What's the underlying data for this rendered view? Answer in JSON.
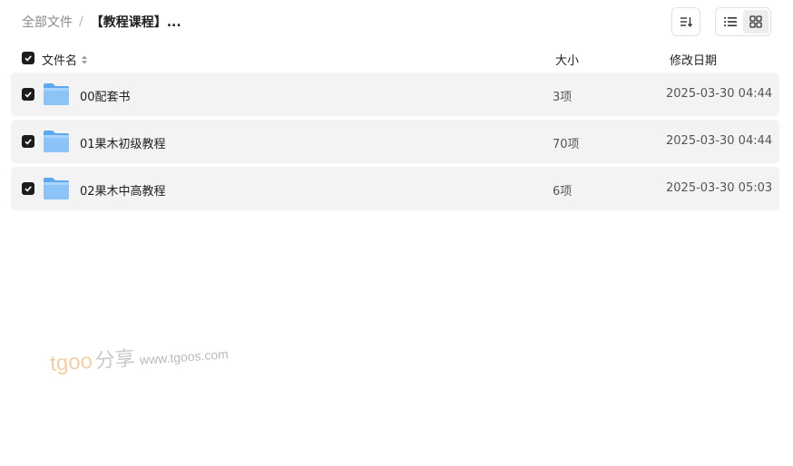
{
  "breadcrumb": {
    "root": "全部文件",
    "separator": "/",
    "current": "【教程课程】..."
  },
  "toolbar": {
    "sort_icon": "sort-descending-icon",
    "list_view_icon": "list-view-icon",
    "grid_view_icon": "grid-view-icon"
  },
  "columns": {
    "name": "文件名",
    "size": "大小",
    "date": "修改日期"
  },
  "files": [
    {
      "name": "00配套书",
      "size": "3项",
      "date": "2025-03-30 04:44",
      "checked": true
    },
    {
      "name": "01果木初级教程",
      "size": "70项",
      "date": "2025-03-30 04:44",
      "checked": true
    },
    {
      "name": "02果木中高教程",
      "size": "6项",
      "date": "2025-03-30 05:03",
      "checked": true
    }
  ],
  "watermark": {
    "brand": "tgoo",
    "share": "分享",
    "url": "www.tgoos.com"
  },
  "colors": {
    "row_bg": "#f3f3f3",
    "checkbox": "#1c1c1c",
    "folder": "#7cb8f4"
  }
}
